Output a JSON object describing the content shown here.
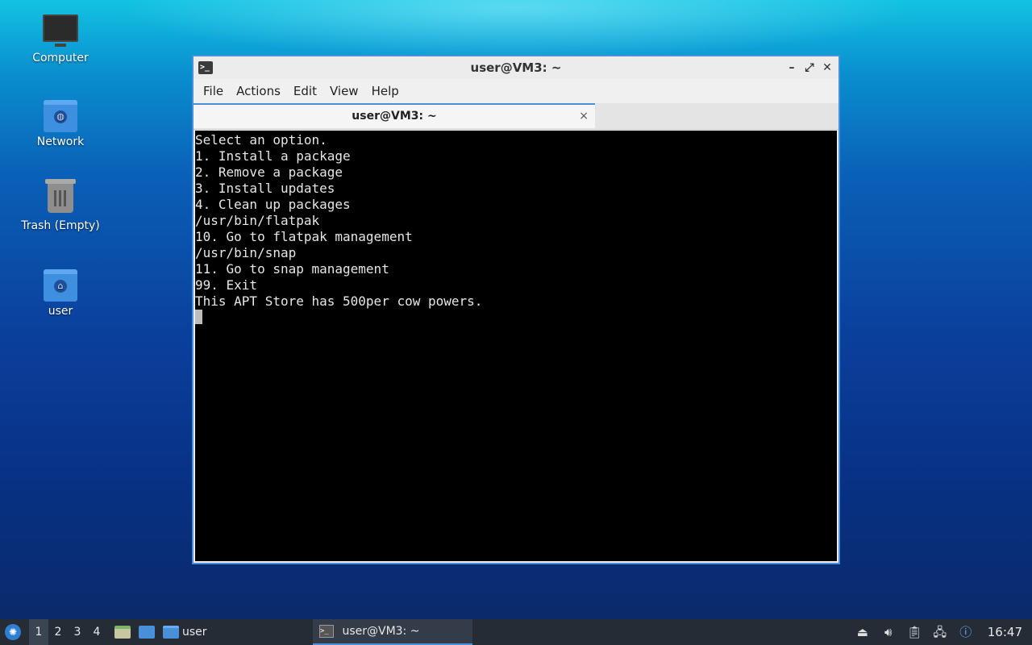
{
  "desktop": {
    "icons": [
      {
        "label": "Computer"
      },
      {
        "label": "Network"
      },
      {
        "label": "Trash (Empty)"
      },
      {
        "label": "user"
      }
    ]
  },
  "window": {
    "title": "user@VM3: ~",
    "menu": [
      "File",
      "Actions",
      "Edit",
      "View",
      "Help"
    ],
    "tab_title": "user@VM3: ~",
    "tab_close": "×",
    "controls": {
      "minimize": "–",
      "maximize": "⤢",
      "close": "✕"
    }
  },
  "terminal": {
    "lines": [
      "Select an option.",
      "1. Install a package",
      "2. Remove a package",
      "3. Install updates",
      "4. Clean up packages",
      "/usr/bin/flatpak",
      "10. Go to flatpak management",
      "/usr/bin/snap",
      "11. Go to snap management",
      "99. Exit",
      "This APT Store has 500per cow powers."
    ]
  },
  "taskbar": {
    "workspaces": [
      "1",
      "2",
      "3",
      "4"
    ],
    "active_workspace": "1",
    "folder_label": "user",
    "task_label": "user@VM3: ~",
    "clock": "16:47"
  },
  "colors": {
    "accent": "#4a90d9",
    "terminal_bg": "#000000",
    "terminal_fg": "#e6e6e6",
    "taskbar_bg": "#252c35"
  }
}
